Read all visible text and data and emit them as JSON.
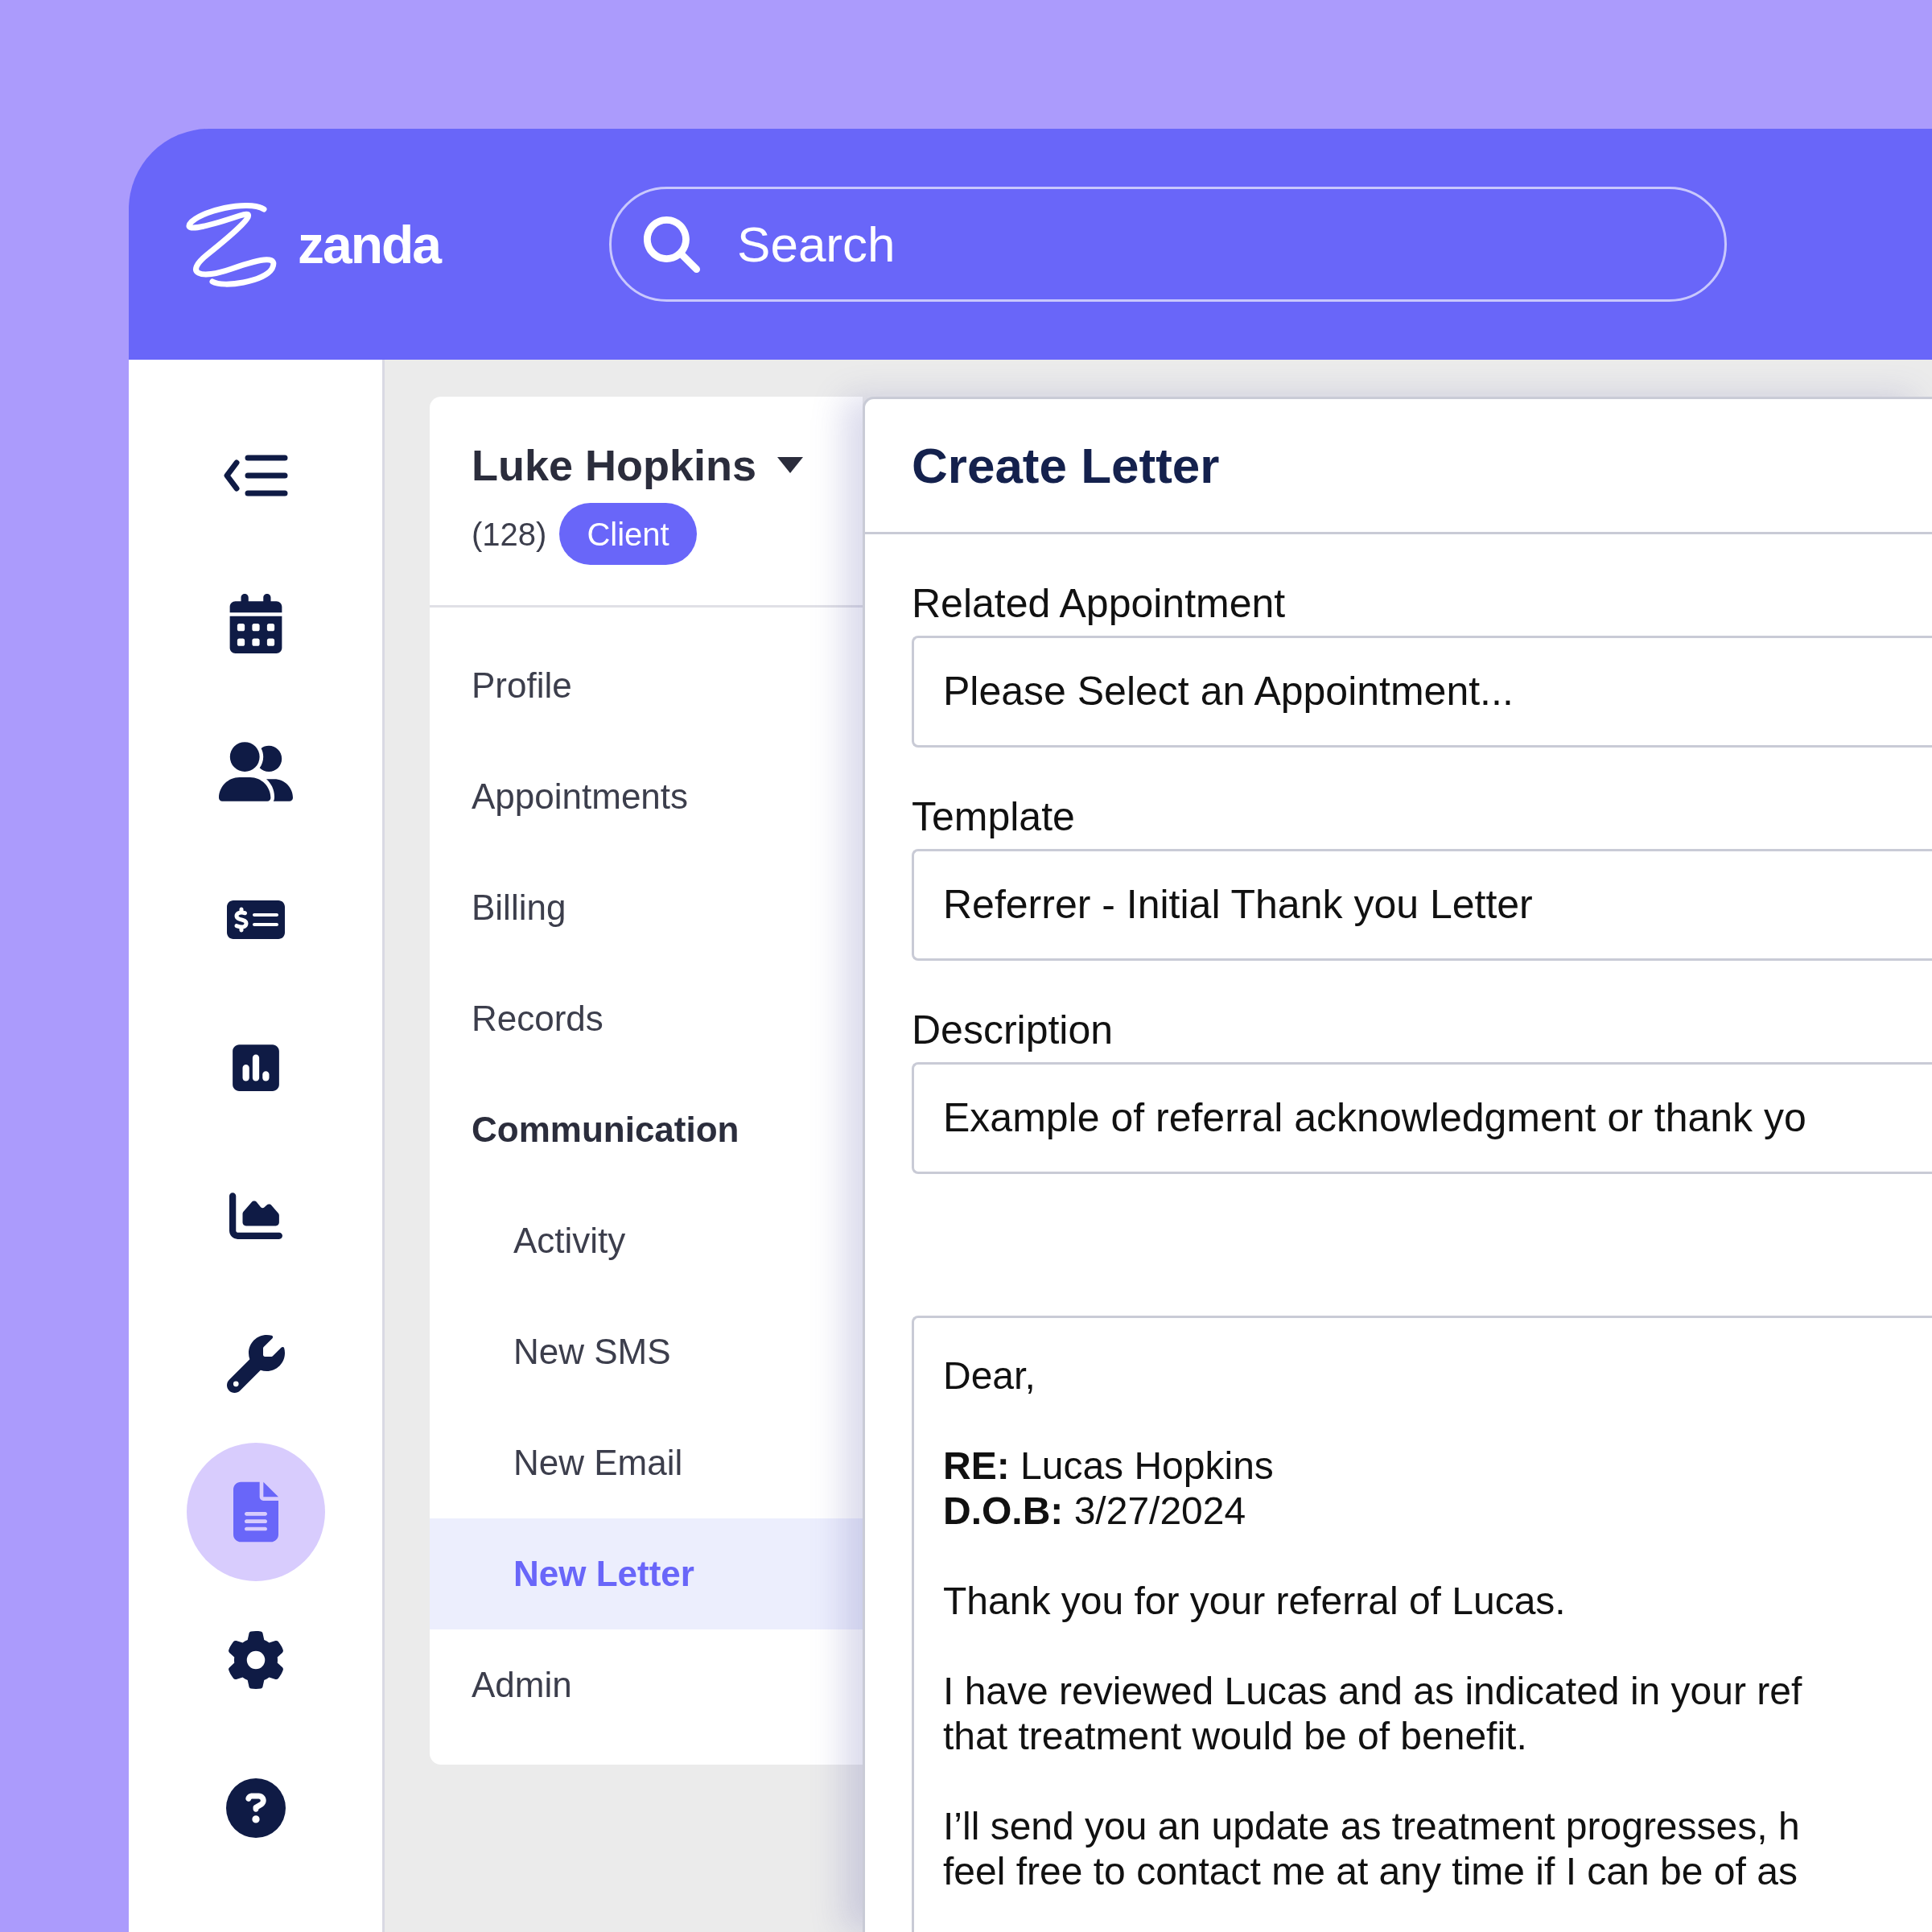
{
  "header": {
    "logo": "zanda",
    "search": {
      "placeholder": "Search"
    }
  },
  "sidebar": {
    "items": [
      {
        "selected": false
      },
      {
        "selected": false
      },
      {
        "selected": false
      },
      {
        "selected": false
      },
      {
        "selected": false
      },
      {
        "selected": false
      },
      {
        "selected": false
      },
      {
        "selected": true
      },
      {
        "selected": false
      },
      {
        "selected": false
      }
    ]
  },
  "client": {
    "name": "Luke Hopkins",
    "count": "(128)",
    "badge": "Client",
    "nav": [
      {
        "label": "Profile",
        "kind": "link",
        "selected": false
      },
      {
        "label": "Appointments",
        "kind": "link",
        "selected": false
      },
      {
        "label": "Billing",
        "kind": "link",
        "selected": false
      },
      {
        "label": "Records",
        "kind": "link",
        "selected": false
      },
      {
        "label": "Communication",
        "kind": "section",
        "selected": false
      },
      {
        "label": "Activity",
        "kind": "sub",
        "selected": false
      },
      {
        "label": "New SMS",
        "kind": "sub",
        "selected": false
      },
      {
        "label": "New Email",
        "kind": "sub",
        "selected": false
      },
      {
        "label": "New Letter",
        "kind": "sub",
        "selected": true
      },
      {
        "label": "Admin",
        "kind": "link",
        "selected": false
      }
    ]
  },
  "letter_form": {
    "title": "Create Letter",
    "fields": [
      {
        "label": "Related Appointment",
        "value": "Please Select an Appointment..."
      },
      {
        "label": "Template",
        "value": "Referrer - Initial Thank you Letter"
      },
      {
        "label": "Description",
        "value": "Example of referral acknowledgment or thank yo"
      }
    ],
    "body": [
      [
        "Dear,"
      ],
      [
        "**RE:** Lucas Hopkins",
        "**D.O.B:** 3/27/2024"
      ],
      [
        "Thank you for your referral of Lucas."
      ],
      [
        "I have reviewed Lucas and as indicated in your ref",
        "that treatment would be of benefit."
      ],
      [
        "I’ll send you an update as treatment progresses, h",
        "feel free to contact me at any time if I can be of as"
      ]
    ]
  }
}
